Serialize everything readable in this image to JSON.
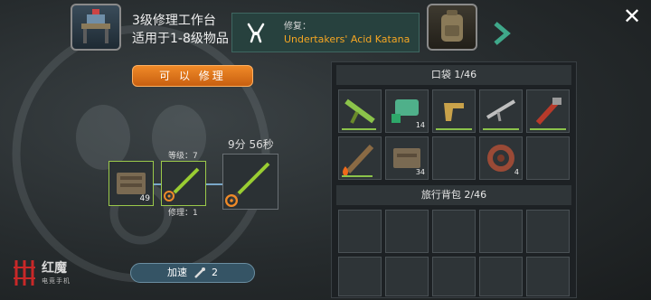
{
  "header": {
    "bench_title": "3级修理工作台",
    "bench_subtitle": "适用于1-8级物品",
    "repair_label": "修复：",
    "repair_item": "Undertakers' Acid Katana"
  },
  "actions": {
    "repair_button": "可 以 修理",
    "speed_up_label": "加速",
    "speed_up_cost": "2"
  },
  "repair": {
    "toolbox_count": "49",
    "level_label": "等级：7",
    "repair_count_label": "修理：1",
    "timer": "9分 56秒"
  },
  "pocket": {
    "header": "口袋 1/46",
    "items": [
      {
        "icon": "green-rifle-icon",
        "count": "",
        "durability": 0.9
      },
      {
        "icon": "green-gadget-icon",
        "count": "14",
        "durability": null
      },
      {
        "icon": "golden-pistol-icon",
        "count": "",
        "durability": 0.95
      },
      {
        "icon": "assault-rifle-icon",
        "count": "",
        "durability": 1.0
      },
      {
        "icon": "pipe-wrench-icon",
        "count": "",
        "durability": 1.0
      },
      {
        "icon": "spiked-bat-icon",
        "count": "",
        "durability": 0.85
      },
      {
        "icon": "toolbox-icon",
        "count": "34",
        "durability": null
      },
      {
        "icon": "empty",
        "count": "",
        "durability": null
      },
      {
        "icon": "rope-coil-icon",
        "count": "4",
        "durability": null
      },
      {
        "icon": "empty",
        "count": "",
        "durability": null
      }
    ]
  },
  "backpack": {
    "header": "旅行背包 2/46"
  },
  "branding": {
    "logo_text": "红魔",
    "logo_sub": "电竞手机"
  },
  "colors": {
    "accent_orange": "#f08a28",
    "item_name_orange": "#f5a623",
    "durability_green": "#8bc34a"
  }
}
